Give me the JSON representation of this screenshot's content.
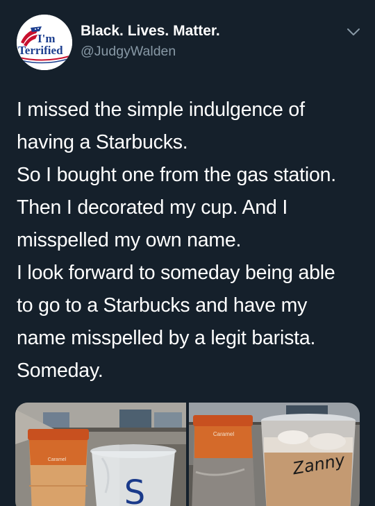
{
  "author": {
    "display_name": "Black. Lives. Matter.",
    "handle": "@JudgyWalden",
    "avatar": {
      "line1": "I'm",
      "line2": "Terrified"
    }
  },
  "menu_icon": "chevron-down-icon",
  "tweet": {
    "lines": [
      "I missed the simple indulgence of",
      "having a Starbucks.",
      "So I bought one from the gas station.",
      "Then I decorated my cup. And I",
      "misspelled my own name.",
      "I look forward to someday being able",
      "to go to a Starbucks and have my",
      "name misspelled by a legit barista.",
      "Someday."
    ]
  },
  "media": {
    "photo1": {
      "cup_label": "Caramel",
      "cup_letter": "S"
    },
    "photo2": {
      "cup_label": "Caramel",
      "handwritten_name": "Zanny"
    }
  },
  "colors": {
    "background": "#15202b",
    "secondary_text": "#8899a6",
    "avatar_red": "#c8102e",
    "avatar_blue": "#1d3f8f"
  }
}
